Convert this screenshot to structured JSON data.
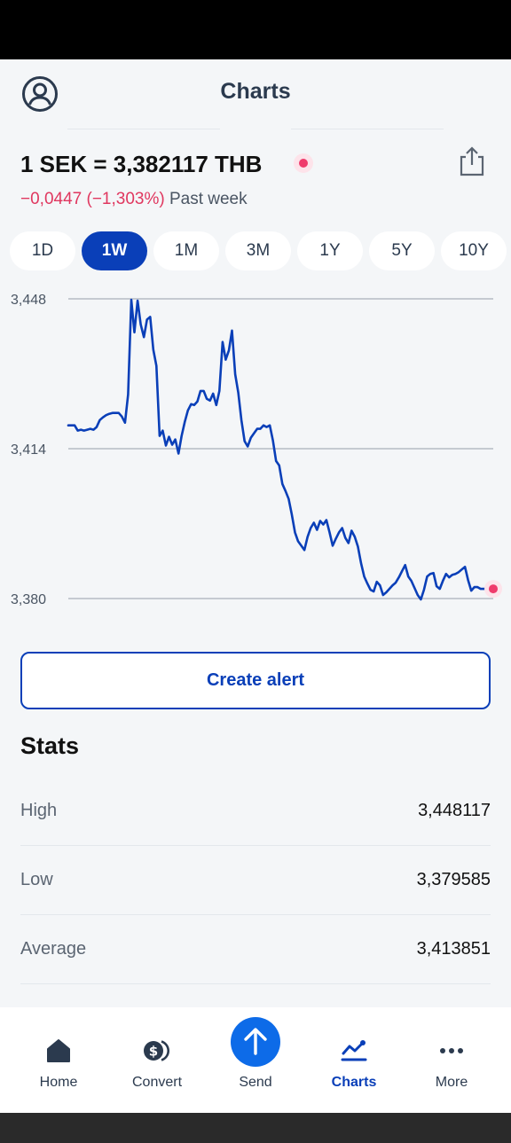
{
  "header": {
    "title": "Charts"
  },
  "rate": {
    "text": "1 SEK = 3,382117 THB"
  },
  "change": {
    "value": "−0,0447 (−1,303%)",
    "period": "Past week"
  },
  "ranges": [
    "1D",
    "1W",
    "1M",
    "3M",
    "1Y",
    "5Y",
    "10Y"
  ],
  "selected_range": "1W",
  "chart_data": {
    "type": "line",
    "y_ticks": [
      "3,448",
      "3,414",
      "3,380"
    ],
    "ylim": [
      3.38,
      3.448
    ],
    "grid": true,
    "line_color": "#0a3fb8",
    "marker_color": "#ef3b6c",
    "series": [
      {
        "values": [
          3.4193,
          3.4193,
          3.4193,
          3.4181,
          3.4183,
          3.4181,
          3.4183,
          3.4185,
          3.4183,
          3.4189,
          3.4205,
          3.4211,
          3.4216,
          3.4219,
          3.4221,
          3.4221,
          3.4221,
          3.4213,
          3.4199,
          3.4263,
          3.4478,
          3.4404,
          3.4476,
          3.4422,
          3.4393,
          3.4433,
          3.4439,
          3.4365,
          3.4328,
          3.4169,
          3.4181,
          3.4147,
          3.4167,
          3.4149,
          3.4161,
          3.4129,
          3.4169,
          3.4201,
          3.4227,
          3.4241,
          3.4239,
          3.4247,
          3.4271,
          3.4271,
          3.4253,
          3.4249,
          3.4265,
          3.4239,
          3.4271,
          3.4382,
          3.4342,
          3.4363,
          3.4408,
          3.4309,
          3.4267,
          3.4205,
          3.4157,
          3.4145,
          3.4165,
          3.4175,
          3.4185,
          3.4185,
          3.4193,
          3.4189,
          3.4193,
          3.4159,
          3.4112,
          3.4102,
          3.406,
          3.4044,
          3.4026,
          3.3991,
          3.395,
          3.393,
          3.392,
          3.391,
          3.394,
          3.396,
          3.3972,
          3.3956,
          3.3976,
          3.3968,
          3.3978,
          3.395,
          3.392,
          3.3936,
          3.395,
          3.396,
          3.3938,
          3.3926,
          3.3954,
          3.394,
          3.3918,
          3.388,
          3.385,
          3.3834,
          3.382,
          3.3816,
          3.3838,
          3.383,
          3.3808,
          3.3814,
          3.3822,
          3.383,
          3.3836,
          3.3848,
          3.3862,
          3.3876,
          3.385,
          3.384,
          3.3824,
          3.3808,
          3.3798,
          3.382,
          3.385,
          3.3856,
          3.3858,
          3.3828,
          3.3822,
          3.384,
          3.3856,
          3.3848,
          3.3854,
          3.3856,
          3.386,
          3.3866,
          3.3872,
          3.3842,
          3.3818,
          3.3826,
          3.3826,
          3.3822,
          3.3822,
          3.3822,
          3.3822,
          3.3822
        ]
      }
    ]
  },
  "create_alert_label": "Create alert",
  "stats": {
    "title": "Stats",
    "rows": [
      {
        "label": "High",
        "value": "3,448117"
      },
      {
        "label": "Low",
        "value": "3,379585"
      },
      {
        "label": "Average",
        "value": "3,413851"
      }
    ]
  },
  "nav": {
    "items": [
      {
        "label": "Home",
        "icon": "home-icon"
      },
      {
        "label": "Convert",
        "icon": "convert-icon"
      },
      {
        "label": "Send",
        "icon": "send-icon"
      },
      {
        "label": "Charts",
        "icon": "charts-icon",
        "active": true
      },
      {
        "label": "More",
        "icon": "more-icon"
      }
    ]
  },
  "colors": {
    "accent": "#0a3fb8",
    "negative": "#e0375f",
    "send": "#0d6be8"
  }
}
